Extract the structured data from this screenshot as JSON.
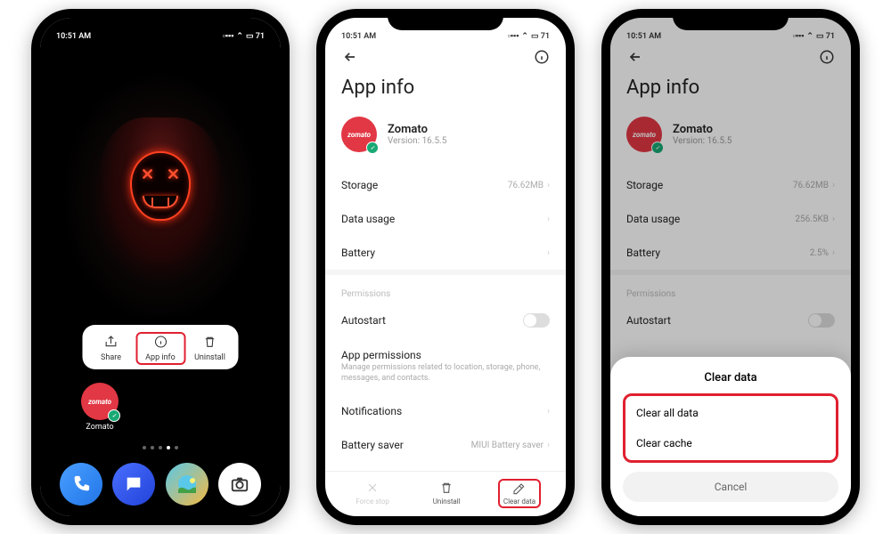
{
  "status": {
    "time": "10:51 AM",
    "signal": "▮▮▮▯",
    "wifi": "📶",
    "battery": "71"
  },
  "home": {
    "context_menu": [
      {
        "label": "Share",
        "icon": "share"
      },
      {
        "label": "App info",
        "icon": "info",
        "highlight": true
      },
      {
        "label": "Uninstall",
        "icon": "trash"
      }
    ],
    "app_name": "Zomato",
    "dock": [
      "Phone",
      "Messages",
      "Gallery",
      "Camera"
    ]
  },
  "appinfo": {
    "title": "App info",
    "app_name": "Zomato",
    "version_label": "Version: 16.5.5",
    "rows_basic": {
      "storage": {
        "label": "Storage",
        "value": "76.62MB"
      },
      "data_usage": {
        "label": "Data usage",
        "value": ""
      },
      "battery": {
        "label": "Battery",
        "value": ""
      }
    },
    "rows_dim": {
      "storage": {
        "label": "Storage",
        "value": "76.62MB"
      },
      "data_usage": {
        "label": "Data usage",
        "value": "256.5KB"
      },
      "battery": {
        "label": "Battery",
        "value": "2.5%"
      }
    },
    "permissions_label": "Permissions",
    "autostart_label": "Autostart",
    "app_permissions_label": "App permissions",
    "app_permissions_sub": "Manage permissions related to location, storage, phone, messages, and contacts.",
    "notifications_label": "Notifications",
    "battery_saver_label": "Battery saver",
    "battery_saver_value": "MIUI Battery saver",
    "bottom_actions": {
      "force_stop": "Force stop",
      "uninstall": "Uninstall",
      "clear_data": "Clear data"
    }
  },
  "dialog": {
    "title": "Clear data",
    "opt1": "Clear all data",
    "opt2": "Clear cache",
    "cancel": "Cancel"
  }
}
